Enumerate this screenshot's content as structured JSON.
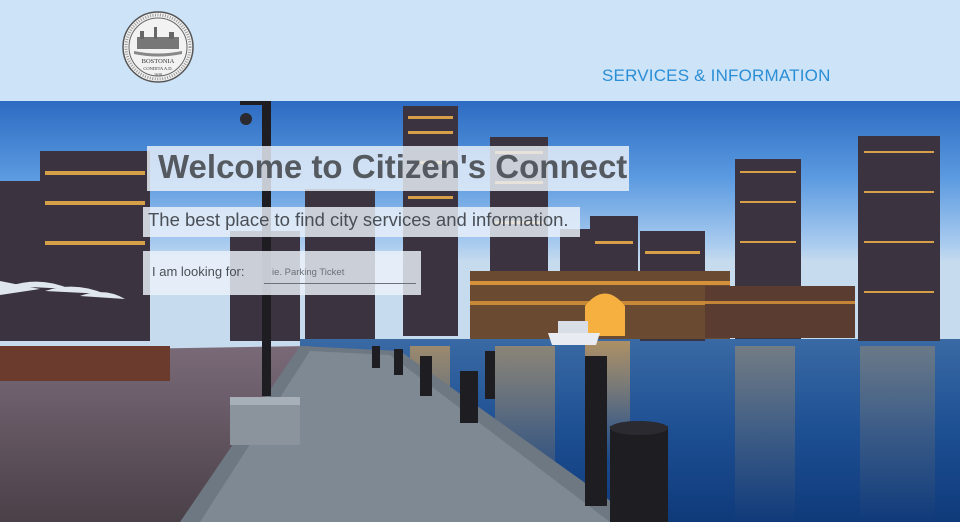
{
  "header": {
    "seal_alt": "City of Boston seal",
    "seal_text_top": "BOSTONIA",
    "seal_text_mid": "CONDITA A.D.",
    "seal_text_year": "1630",
    "nav_link": "SERVICES & INFORMATION"
  },
  "hero": {
    "title": "Welcome to Citizen's Connect",
    "tagline": "The best place to find city services and information.",
    "search_label": "I am looking for:",
    "search_placeholder": "ie. Parking Ticket",
    "search_value": ""
  },
  "colors": {
    "header_bg": "#cde3f7",
    "nav_link": "#2a8ed6",
    "title_text": "#555a60"
  }
}
